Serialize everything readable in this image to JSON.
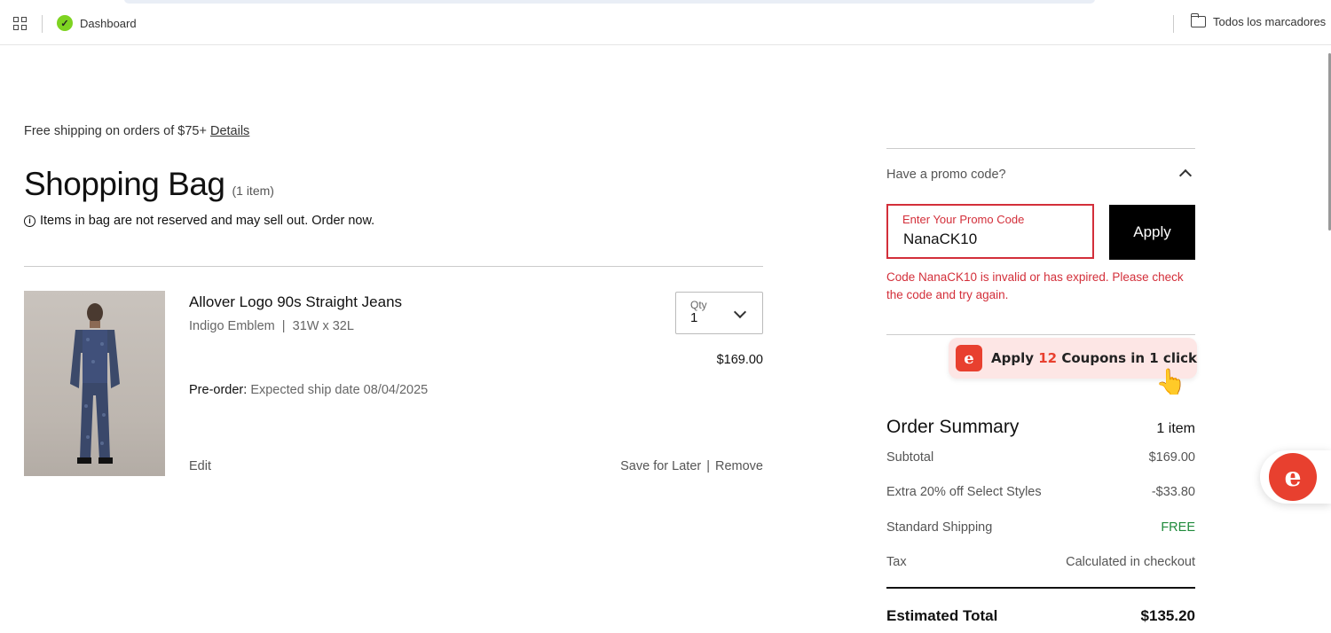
{
  "bookmarks_bar": {
    "dashboard_label": "Dashboard",
    "all_bookmarks_label": "Todos los marcadores"
  },
  "banner": {
    "shipping_text": "Free shipping on orders of $75+",
    "details_link": "Details"
  },
  "bag": {
    "title": "Shopping Bag",
    "count": "(1 item)",
    "warning": "Items in bag are not reserved and may sell out. Order now."
  },
  "item": {
    "name": "Allover Logo 90s Straight Jeans",
    "color": "Indigo Emblem",
    "meta_sep": "|",
    "size": "31W x 32L",
    "qty_label": "Qty",
    "qty_value": "1",
    "price": "$169.00",
    "preorder_label": "Pre-order:",
    "preorder_value": "Expected ship date 08/04/2025",
    "edit_label": "Edit",
    "save_label": "Save for Later",
    "action_sep": "|",
    "remove_label": "Remove"
  },
  "promo": {
    "header": "Have a promo code?",
    "placeholder": "Enter Your Promo Code",
    "value": "NanaCK10",
    "apply_label": "Apply",
    "error": "Code NanaCK10 is invalid or has expired. Please check the code and try again."
  },
  "coupon_extension": {
    "pre": "Apply",
    "count": "12",
    "post": "Coupons in 1 click"
  },
  "summary": {
    "title": "Order Summary",
    "count": "1 item",
    "rows": [
      {
        "label": "Subtotal",
        "value": "$169.00"
      },
      {
        "label": "Extra 20% off Select Styles",
        "value": "-$33.80"
      },
      {
        "label": "Standard Shipping",
        "value": "FREE"
      },
      {
        "label": "Tax",
        "value": "Calculated in checkout"
      }
    ],
    "total_label": "Estimated Total",
    "total_value": "$135.20"
  },
  "colors": {
    "error_red": "#d32f3a",
    "free_green": "#1f8a3b",
    "extension_red": "#e8402f"
  }
}
